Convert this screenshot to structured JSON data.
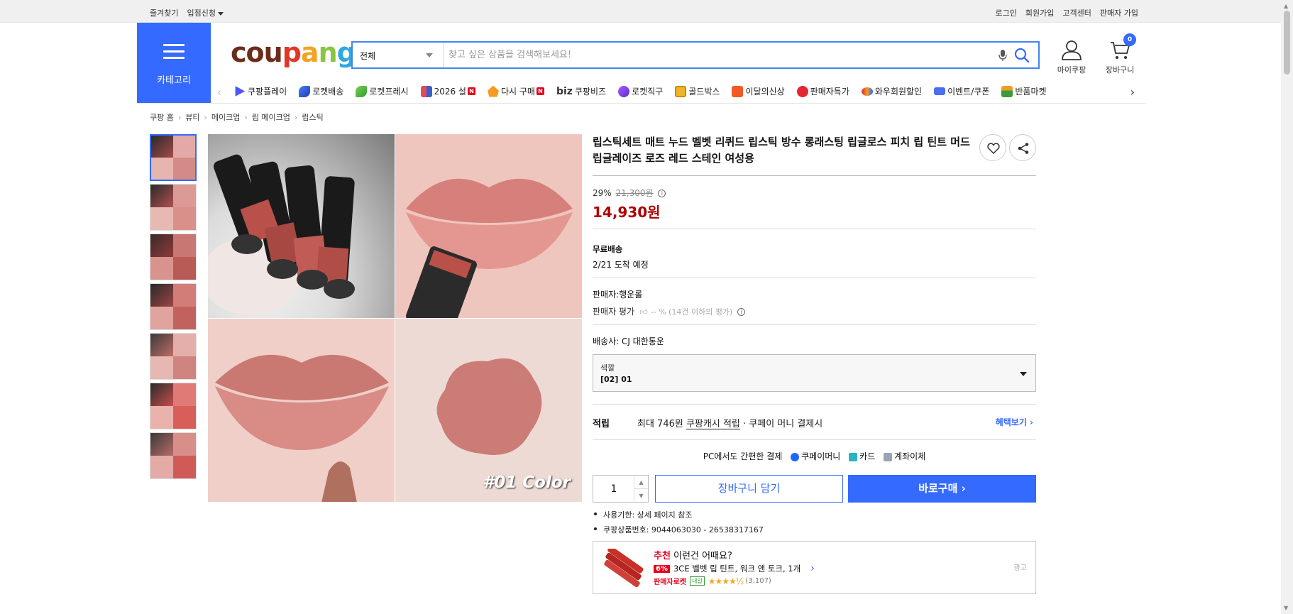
{
  "topbar": {
    "favorites": "즐겨찾기",
    "vendor_apply": "입점신청",
    "login": "로그인",
    "signup": "회원가입",
    "customer_center": "고객센터",
    "seller_signup": "판매자 가입"
  },
  "header": {
    "category_label": "카테고리",
    "logo_text": "coupang",
    "search_category": "전체",
    "search_placeholder": "찾고 싶은 상품을 검색해보세요!",
    "mypage_label": "마이쿠팡",
    "cart_label": "장바구니",
    "cart_count": "0",
    "brand_color": "#346aff"
  },
  "nav": {
    "items": [
      {
        "label": "쿠팡플레이",
        "icon": "play-icon"
      },
      {
        "label": "로켓배송",
        "icon": "rocket-icon"
      },
      {
        "label": "로켓프레시",
        "icon": "rocket-fresh-icon"
      },
      {
        "label": "2026 설",
        "icon": "gift-icon",
        "badge": "N"
      },
      {
        "label": "다시 구매",
        "icon": "repurchase-icon",
        "badge": "N"
      },
      {
        "label": "쿠팡비즈",
        "icon": "biz-icon",
        "prefix": "biz"
      },
      {
        "label": "로켓직구",
        "icon": "global-icon"
      },
      {
        "label": "골드박스",
        "icon": "goldbox-icon"
      },
      {
        "label": "이달의신상",
        "icon": "new-icon"
      },
      {
        "label": "판매자특가",
        "icon": "seller-deal-icon"
      },
      {
        "label": "와우회원할인",
        "icon": "wow-icon"
      },
      {
        "label": "이벤트/쿠폰",
        "icon": "coupon-icon"
      },
      {
        "label": "반품마켓",
        "icon": "return-market-icon"
      }
    ]
  },
  "breadcrumb": [
    "쿠팡 홈",
    "뷰티",
    "메이크업",
    "립 메이크업",
    "립스틱"
  ],
  "product": {
    "title": "립스틱세트 매트 누드 벨벳 리퀴드 립스틱 방수 롱래스팅 립글로스 피치 립 틴트 머드 립글레이즈 로즈 레드 스테인 여성용",
    "discount_pct": "29%",
    "original_price": "21,300원",
    "price": "14,930원",
    "shipping_label": "무료배송",
    "arrival": "2/21 도착 예정",
    "seller": "판매자:행운롤",
    "seller_rating_label": "판매자 평가",
    "seller_rating_value": "-- % (14건 이하의 평가)",
    "courier": "배송사:  CJ 대한통운",
    "option_label": "색깔",
    "option_value": "[02] 01",
    "image_caption": "#01 Color"
  },
  "reward": {
    "label": "적립",
    "text_prefix": "최대 746원 ",
    "text_link": "쿠팡캐시 적립",
    "text_suffix": " · 쿠페이 머니 결제시",
    "more": "혜택보기"
  },
  "payment": {
    "text": "PC에서도 간편한 결제",
    "coupay": "쿠페이머니",
    "card": "카드",
    "account": "계좌이체"
  },
  "purchase": {
    "quantity": "1",
    "add_to_cart": "장바구니 담기",
    "buy_now": "바로구매"
  },
  "notes": [
    "사용기한: 상세 페이지 참조",
    "쿠팡상품번호: 9044063030 - 26538317167"
  ],
  "recommend": {
    "label_red": "추천",
    "label_rest": " 이런건 어때요?",
    "discount": "6%",
    "name": "3CE 벨벳 립 틴트, 워크 앤 토크, 1개",
    "rocket": "판매자로켓",
    "tomorrow": "내일",
    "stars": "★★★★½",
    "reviews": "(3,107)",
    "ad": "광고"
  }
}
